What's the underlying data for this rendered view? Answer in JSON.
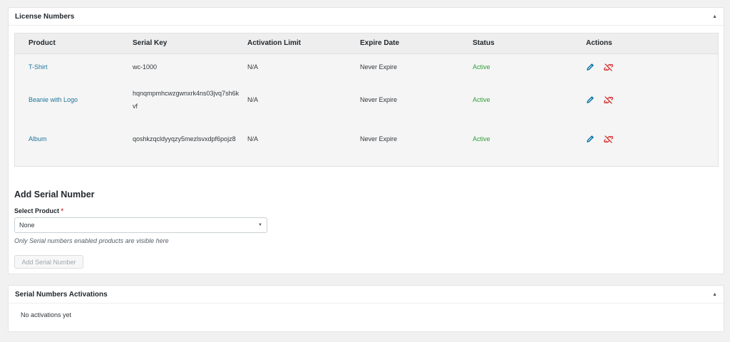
{
  "license_box": {
    "title": "License Numbers",
    "toggle": "▲",
    "columns": [
      "Product",
      "Serial Key",
      "Activation Limit",
      "Expire Date",
      "Status",
      "Actions"
    ],
    "rows": [
      {
        "product": "T-Shirt",
        "serial_key": "wc-1000",
        "activation_limit": "N/A",
        "expire_date": "Never Expire",
        "status": "Active"
      },
      {
        "product": "Beanie with Logo",
        "serial_key": "hqnqmpmhcwzgwnxrk4ns03jvq7sh6kvf",
        "activation_limit": "N/A",
        "expire_date": "Never Expire",
        "status": "Active"
      },
      {
        "product": "Album",
        "serial_key": "qoshkzqcldyyqzy5mezlsvxdpf6pojz8",
        "activation_limit": "N/A",
        "expire_date": "Never Expire",
        "status": "Active"
      }
    ],
    "action_icons": [
      "edit-icon",
      "delete-icon"
    ],
    "colors": {
      "link": "#21759b",
      "active": "#2e9e3a",
      "edit": "#0073aa",
      "delete": "#d63638"
    }
  },
  "add_serial": {
    "title": "Add Serial Number",
    "select_label": "Select Product",
    "required_mark": "*",
    "select_value": "None",
    "hint": "Only Serial numbers enabled products are visible here",
    "button_label": "Add Serial Number"
  },
  "activations_box": {
    "title": "Serial Numbers Activations",
    "toggle": "▲",
    "empty_text": "No activations yet"
  }
}
